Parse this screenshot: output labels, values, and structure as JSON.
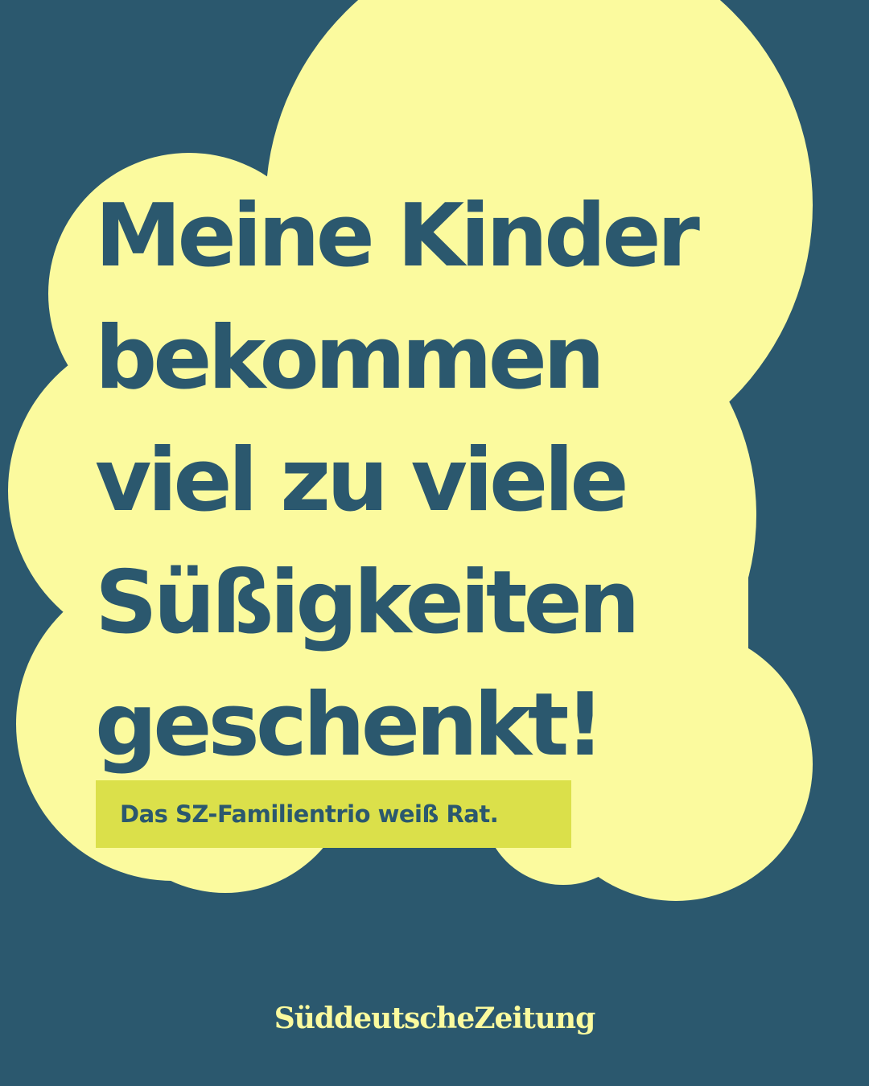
{
  "colors": {
    "background": "#2b586e",
    "cloud": "#fbfa9e",
    "headline_text": "#2b586e",
    "subline_background": "#dbe04a",
    "brand_text": "#fbfa9e"
  },
  "headline": {
    "lines": [
      "Meine Kinder",
      "bekommen",
      "viel zu viele",
      "Süßigkeiten",
      "geschenkt!"
    ]
  },
  "subline": {
    "text": "Das SZ-Familientrio weiß Rat."
  },
  "brand": {
    "logo_text": "SüddeutscheZeitung"
  }
}
